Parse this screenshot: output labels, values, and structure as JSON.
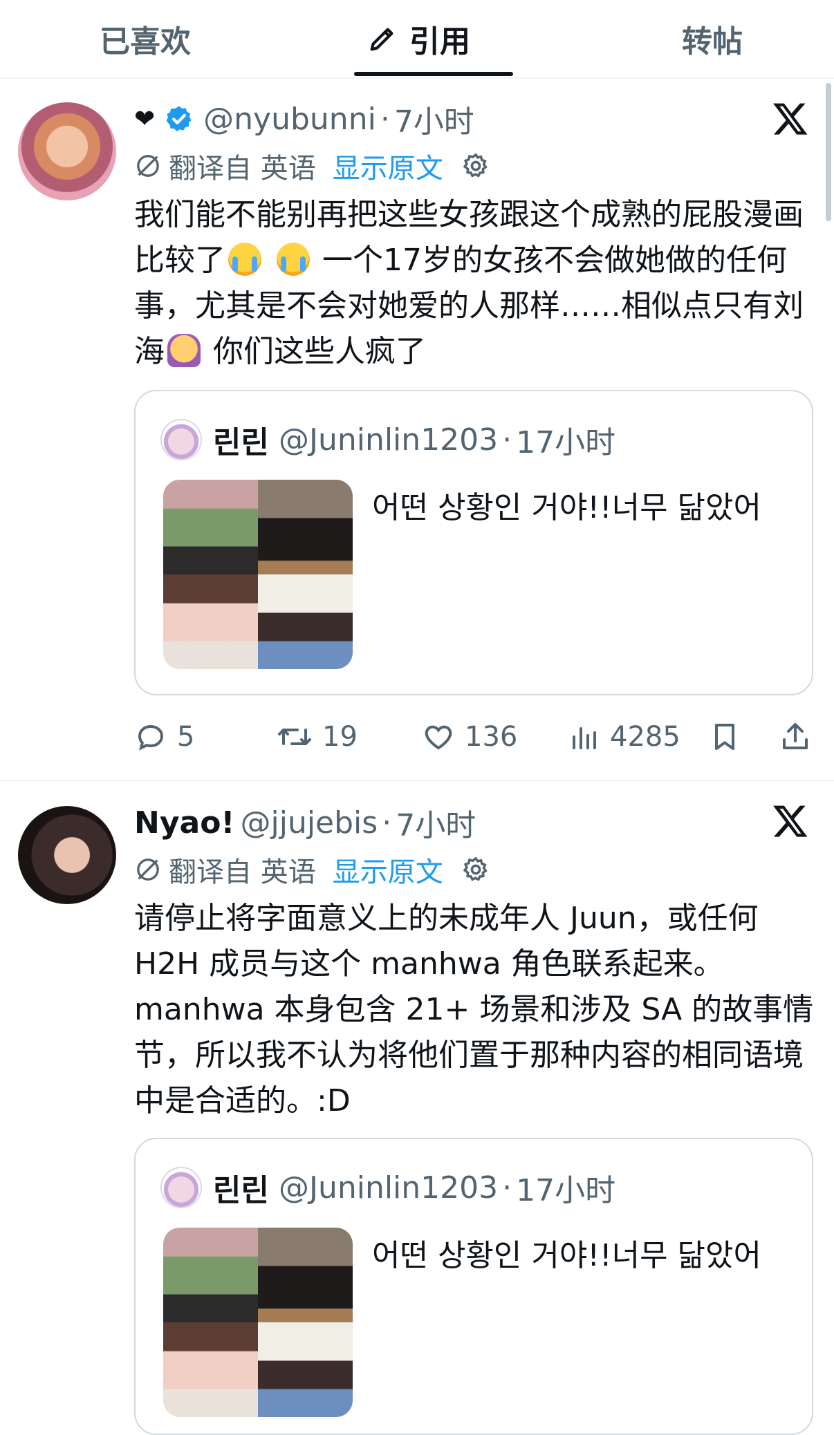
{
  "tabs": [
    {
      "label": "已喜欢"
    },
    {
      "label": "引用"
    },
    {
      "label": "转帖"
    }
  ],
  "active_tab": "引用",
  "colors": {
    "accent": "#1d9bf0",
    "secondary_text": "#536471",
    "primary_text": "#0f1419"
  },
  "tweets": [
    {
      "display_name": "❤",
      "handle": "@nyubunni",
      "dot": "·",
      "time": "7小时",
      "translated_label": "翻译自 英语",
      "show_original": "显示原文",
      "text_parts": [
        "我们能不能别再把这些女孩跟这个成熟的屁股漫画比较了",
        "一个17岁的女孩不会做她做的任何事，尤其是不会对她爱的人那样……相似点只有刘海",
        "你们这些人疯了"
      ],
      "quoted": {
        "name": "린린",
        "handle": "@Juninlin1203",
        "dot": "·",
        "time": "17小时",
        "text": "어떤 상황인 거야!!너무 닮았어"
      },
      "stats": {
        "replies": "5",
        "reposts": "19",
        "likes": "136",
        "views": "4285"
      }
    },
    {
      "display_name": "Nyao!",
      "handle": "@jjujebis",
      "dot": "·",
      "time": "7小时",
      "translated_label": "翻译自 英语",
      "show_original": "显示原文",
      "text": "请停止将字面意义上的未成年人 Juun，或任何 H2H 成员与这个 manhwa 角色联系起来。manhwa 本身包含 21+ 场景和涉及 SA 的故事情节，所以我不认为将他们置于那种内容的相同语境中是合适的。:D",
      "quoted": {
        "name": "린린",
        "handle": "@Juninlin1203",
        "dot": "·",
        "time": "17小时",
        "text": "어떤 상황인 거야!!너무 닮았어"
      }
    }
  ]
}
